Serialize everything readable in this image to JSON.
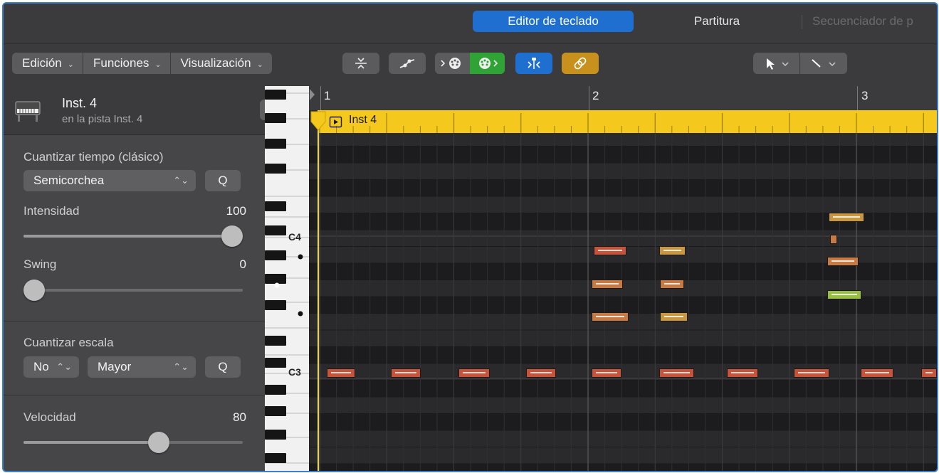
{
  "tabs": [
    {
      "label": "Editor de teclado",
      "active": true
    },
    {
      "label": "Partitura",
      "active": false
    },
    {
      "label": "Secuenciador de p",
      "active": false
    }
  ],
  "toolbar": {
    "menus": [
      "Edición",
      "Funciones",
      "Visualización"
    ],
    "colors": {
      "midi_in_active": "#2fa336",
      "catch": "#1f6fd1",
      "link": "#c8901c"
    }
  },
  "inspector": {
    "track_name": "Inst. 4",
    "track_subtitle": "en la pista Inst. 4",
    "time_quantize_label": "Cuantizar tiempo (clásico)",
    "time_quantize_value": "Semicorchea",
    "q_label": "Q",
    "strength_label": "Intensidad",
    "strength_value": "100",
    "strength_level": 1.0,
    "swing_label": "Swing",
    "swing_value": "0",
    "swing_level": 0.0,
    "scale_quantize_label": "Cuantizar escala",
    "scale_root_value": "No",
    "scale_type_value": "Mayor",
    "velocity_label": "Velocidad",
    "velocity_value": "80",
    "velocity_level": 0.63
  },
  "keyboard": {
    "labels": [
      "C4",
      "C3"
    ]
  },
  "ruler": {
    "bars": [
      "1",
      "2",
      "3"
    ]
  },
  "region": {
    "name": "Inst 4",
    "color": "#f4c81c"
  },
  "notes_colors": {
    "red": "#c8533b",
    "orange": "#c87a45",
    "tan": "#c8973f",
    "green": "#97c043"
  }
}
